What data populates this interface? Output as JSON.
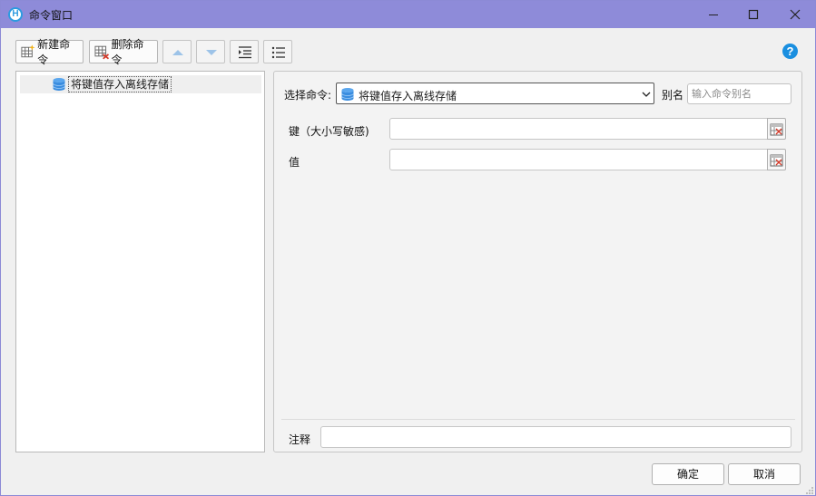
{
  "window": {
    "title": "命令窗口",
    "app_icon_letter": "H"
  },
  "toolbar": {
    "new_label": "新建命令",
    "delete_label": "删除命令",
    "help_glyph": "?"
  },
  "tree": {
    "items": [
      {
        "label": "将键值存入离线存储",
        "icon": "database-icon"
      }
    ]
  },
  "form": {
    "select_label": "选择命令:",
    "selected_command": "将键值存入离线存储",
    "alias_label": "别名",
    "alias_placeholder": "输入命令别名",
    "alias_value": "",
    "key_label": "键（大小写敏感)",
    "key_value": "",
    "value_label": "值",
    "value_value": "",
    "note_label": "注释",
    "note_value": ""
  },
  "footer": {
    "ok_label": "确定",
    "cancel_label": "取消"
  },
  "colors": {
    "titlebar": "#8e8bd9",
    "accent": "#1a8fe0",
    "db_icon": "#3a8de0"
  }
}
